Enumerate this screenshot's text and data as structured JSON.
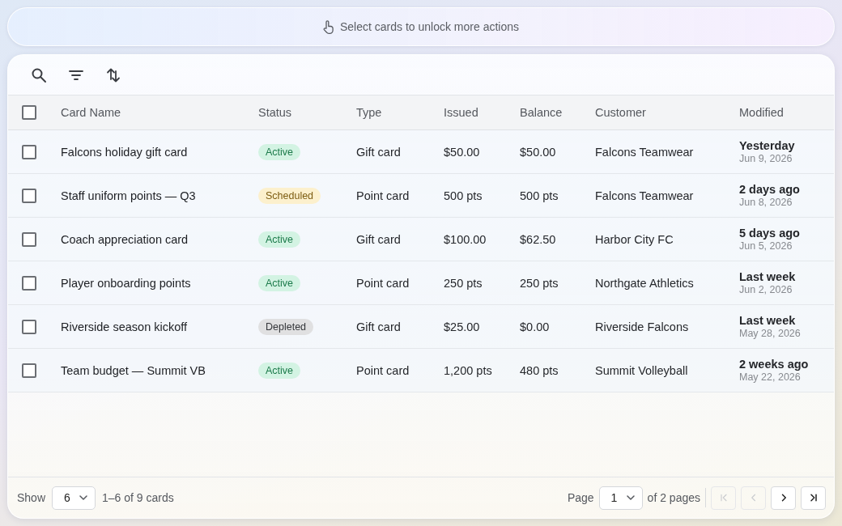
{
  "banner": {
    "text": "Select cards to unlock more actions"
  },
  "table": {
    "select_all": {
      "checked": false
    },
    "columns": [
      "Card Name",
      "Status",
      "Type",
      "Issued",
      "Balance",
      "Customer",
      "Modified"
    ],
    "rows": [
      {
        "selected": false,
        "name": "Falcons holiday gift card",
        "status": {
          "label": "Active",
          "kind": "active"
        },
        "type": "Gift card",
        "issued": "$50.00",
        "balance": "$50.00",
        "customer": "Falcons Teamwear",
        "modified": {
          "relative": "Yesterday",
          "date": "Jun 9, 2026"
        }
      },
      {
        "selected": false,
        "name": "Staff uniform points — Q3",
        "status": {
          "label": "Scheduled",
          "kind": "scheduled"
        },
        "type": "Point card",
        "issued": "500 pts",
        "balance": "500 pts",
        "customer": "Falcons Teamwear",
        "modified": {
          "relative": "2 days ago",
          "date": "Jun 8, 2026"
        }
      },
      {
        "selected": false,
        "name": "Coach appreciation card",
        "status": {
          "label": "Active",
          "kind": "active"
        },
        "type": "Gift card",
        "issued": "$100.00",
        "balance": "$62.50",
        "customer": "Harbor City FC",
        "modified": {
          "relative": "5 days ago",
          "date": "Jun 5, 2026"
        }
      },
      {
        "selected": false,
        "name": "Player onboarding points",
        "status": {
          "label": "Active",
          "kind": "active"
        },
        "type": "Point card",
        "issued": "250 pts",
        "balance": "250 pts",
        "customer": "Northgate Athletics",
        "modified": {
          "relative": "Last week",
          "date": "Jun 2, 2026"
        }
      },
      {
        "selected": false,
        "name": "Riverside season kickoff",
        "status": {
          "label": "Depleted",
          "kind": "depleted"
        },
        "type": "Gift card",
        "issued": "$25.00",
        "balance": "$0.00",
        "customer": "Riverside Falcons",
        "modified": {
          "relative": "Last week",
          "date": "May 28, 2026"
        }
      },
      {
        "selected": false,
        "name": "Team budget — Summit VB",
        "status": {
          "label": "Active",
          "kind": "active"
        },
        "type": "Point card",
        "issued": "1,200 pts",
        "balance": "480 pts",
        "customer": "Summit Volleyball",
        "modified": {
          "relative": "2 weeks ago",
          "date": "May 22, 2026"
        }
      }
    ]
  },
  "footer": {
    "show_label": "Show",
    "page_size": "6",
    "range": "1–6 of 9 cards",
    "page_label": "Page",
    "page": "1",
    "page_total": "of 2 pages",
    "nav": [
      {
        "kind": "first",
        "disabled": true
      },
      {
        "kind": "prev",
        "disabled": true
      },
      {
        "kind": "next",
        "disabled": false
      },
      {
        "kind": "last",
        "disabled": false
      }
    ]
  }
}
